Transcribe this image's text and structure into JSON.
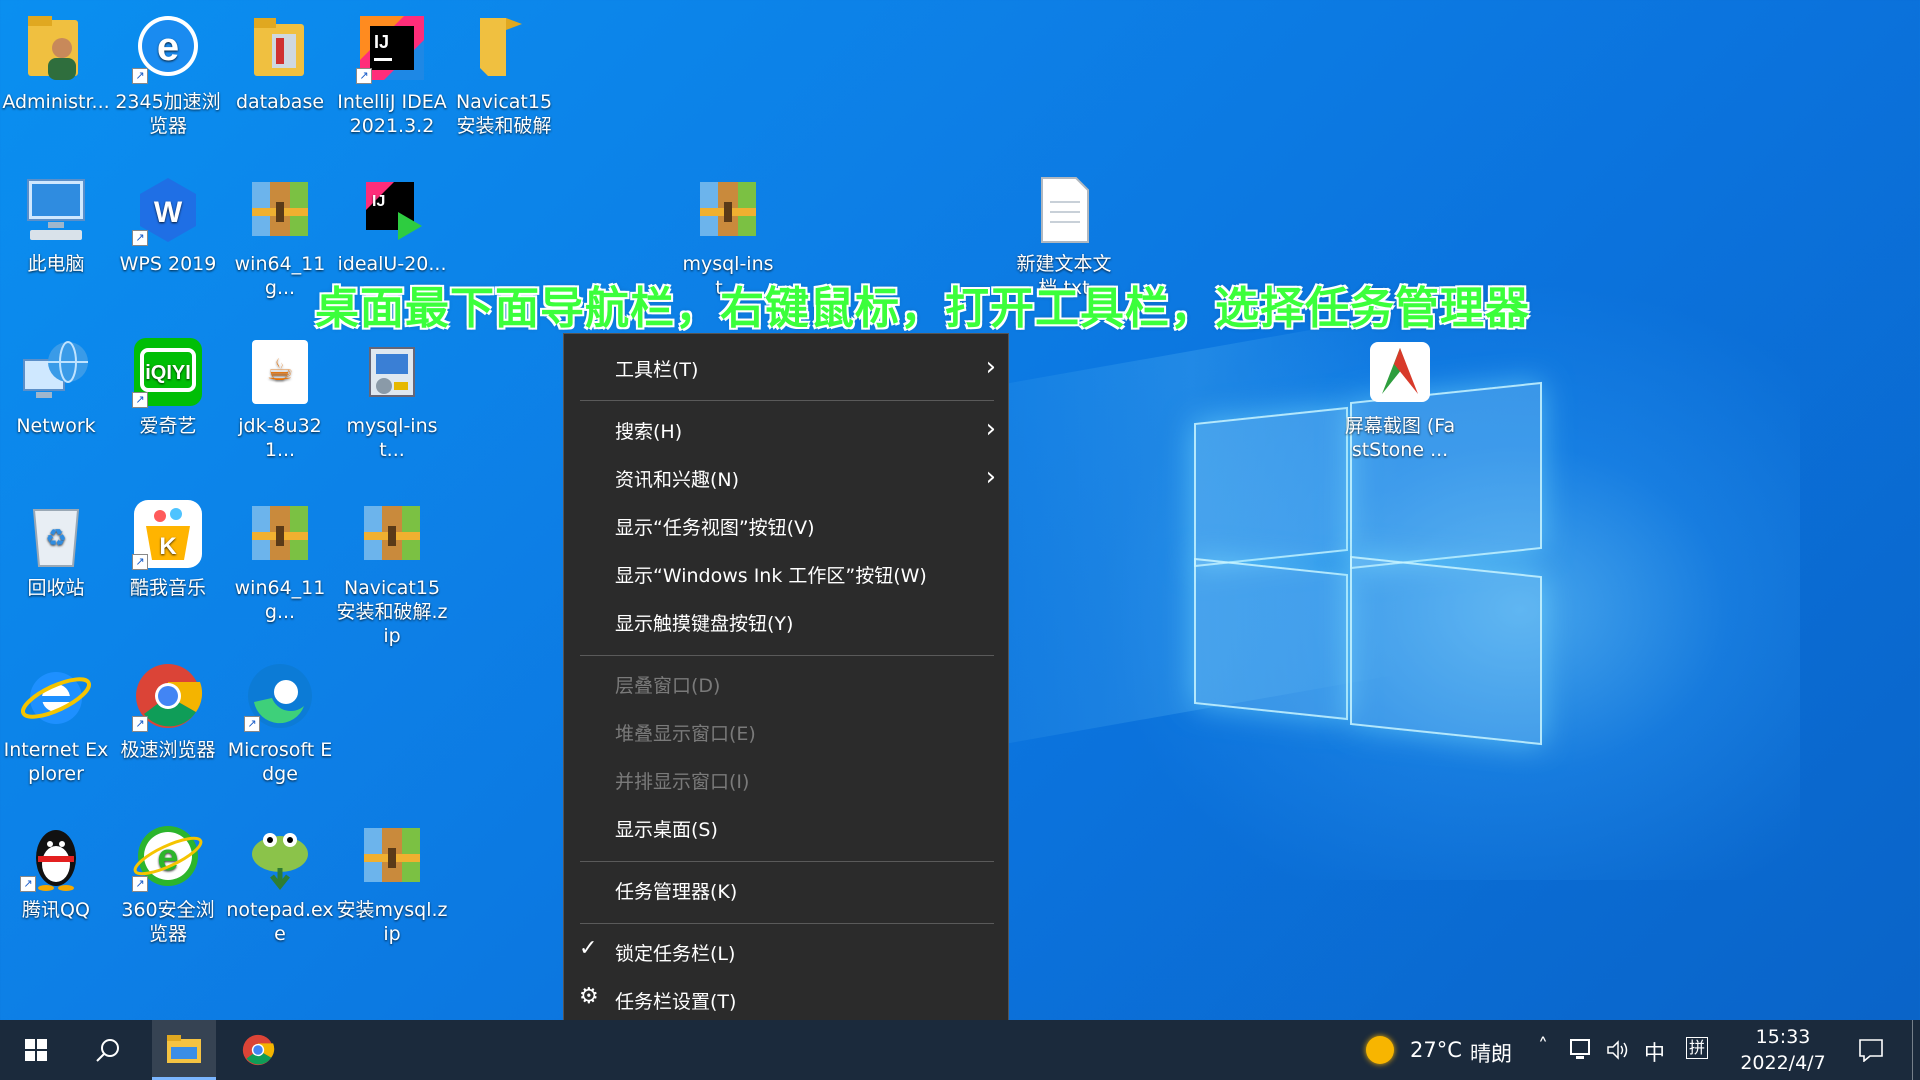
{
  "banner_text": "桌面最下面导航栏，右键鼠标，打开工具栏，选择任务管理器",
  "desktop_icons": [
    {
      "label": "Administr...",
      "icon": "user-folder-icon"
    },
    {
      "label": "2345加速浏览器",
      "icon": "2345-browser-icon"
    },
    {
      "label": "database",
      "icon": "folder-icon"
    },
    {
      "label": "IntelliJ IDEA 2021.3.2",
      "icon": "intellij-idea-icon"
    },
    {
      "label": "Navicat15安装和破解",
      "icon": "folder-icon"
    },
    {
      "label": "此电脑",
      "icon": "computer-icon"
    },
    {
      "label": "WPS 2019",
      "icon": "wps-icon"
    },
    {
      "label": "win64_11g...",
      "icon": "archive-icon"
    },
    {
      "label": "idealU-20...",
      "icon": "intellij-installer-icon"
    },
    {
      "label": "mysql-inst...",
      "icon": "archive-icon"
    },
    {
      "label": "新建文本文档.txt",
      "icon": "text-file-icon"
    },
    {
      "label": "Network",
      "icon": "network-icon"
    },
    {
      "label": "爱奇艺",
      "icon": "iqiyi-icon"
    },
    {
      "label": "jdk-8u321...",
      "icon": "java-icon"
    },
    {
      "label": "mysql-inst...",
      "icon": "installer-icon"
    },
    {
      "label": "屏幕截图 (FastStone ...",
      "icon": "faststone-capture-icon"
    },
    {
      "label": "回收站",
      "icon": "recycle-bin-icon"
    },
    {
      "label": "酷我音乐",
      "icon": "kuwo-music-icon"
    },
    {
      "label": "win64_11g...",
      "icon": "archive-icon"
    },
    {
      "label": "Navicat15安装和破解.zip",
      "icon": "archive-icon"
    },
    {
      "label": "Internet Explorer",
      "icon": "internet-explorer-icon"
    },
    {
      "label": "极速浏览器",
      "icon": "chrome-icon"
    },
    {
      "label": "Microsoft Edge",
      "icon": "edge-icon"
    },
    {
      "label": "腾讯QQ",
      "icon": "qq-penguin-icon"
    },
    {
      "label": "360安全浏览器",
      "icon": "360-browser-icon"
    },
    {
      "label": "notepad.exe",
      "icon": "notepad-plus-plus-icon"
    },
    {
      "label": "安装mysql.zip",
      "icon": "archive-icon"
    }
  ],
  "context_menu": {
    "toolbars": "工具栏(T)",
    "search": "搜索(H)",
    "news": "资讯和兴趣(N)",
    "task_view": "显示“任务视图”按钮(V)",
    "ink": "显示“Windows Ink 工作区”按钮(W)",
    "touch_keyboard": "显示触摸键盘按钮(Y)",
    "cascade": "层叠窗口(D)",
    "stack": "堆叠显示窗口(E)",
    "side_by_side": "并排显示窗口(I)",
    "show_desktop": "显示桌面(S)",
    "task_manager": "任务管理器(K)",
    "lock_taskbar": "锁定任务栏(L)",
    "taskbar_settings": "任务栏设置(T)"
  },
  "taskbar": {
    "weather_temp": "27°C",
    "weather_desc": "晴朗",
    "ime_lang": "中",
    "ime_mode": "拼",
    "time": "15:33",
    "date": "2022/4/7"
  },
  "colors": {
    "banner": "#3bff3b",
    "menu_bg": "#2b2b2b",
    "taskbar_bg": "#1b2a3c",
    "desktop_accent": "#0a8ff0"
  }
}
